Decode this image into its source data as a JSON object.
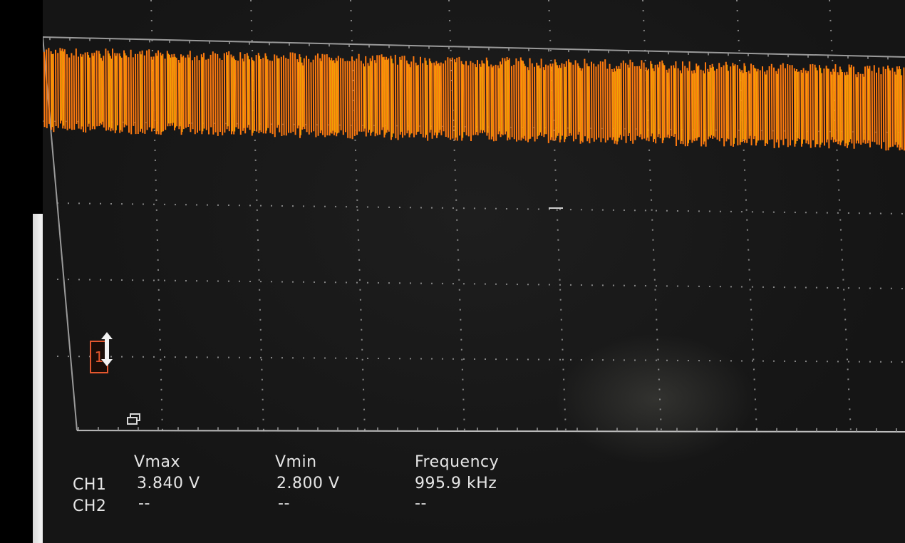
{
  "channel_marker": "1",
  "measurements": {
    "headers": [
      "Vmax",
      "Vmin",
      "Frequency"
    ],
    "rows": [
      {
        "channel": "CH1",
        "values": [
          "3.840 V",
          "2.800 V",
          "995.9 kHz"
        ]
      },
      {
        "channel": "CH2",
        "values": [
          "--",
          "--",
          "--"
        ]
      }
    ]
  },
  "colors": {
    "trace": "#ffb000",
    "trace_edge": "#ff7a10",
    "grid": "#9a9a9a",
    "text": "#e6e6e6",
    "marker": "#e4572e"
  },
  "icons": {
    "channel_offset": "double-arrow-icon",
    "scale": "window-icon"
  }
}
